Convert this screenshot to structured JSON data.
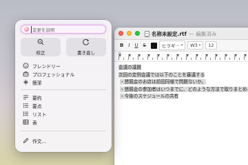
{
  "document_window": {
    "filename": "名称未設定.rtf",
    "separator": "—",
    "state": "編集済み",
    "toolbar": {
      "bold": "B",
      "italic": "I",
      "underline": "U",
      "strikethrough": "S",
      "color": "#111111",
      "font": "ヒラギ···",
      "weight": "W3",
      "size": "12"
    },
    "ruler": {
      "zero_label": "0"
    },
    "content": [
      "会議の議題",
      "次回の定例会議では以下のことを審議する",
      "・懇親会のお店は前回同様で問題ないか。",
      "・懇親会の参加者はいつまでに、どのような方法で取りまとめる",
      "・今後のスケジュールの共有"
    ]
  },
  "writing_tools": {
    "describe_placeholder": "変更を説明",
    "proofread": {
      "label": "校正",
      "icon": "magnifier-icon"
    },
    "rewrite": {
      "label": "書き直し",
      "icon": "rewrite-icon"
    },
    "tone_items": [
      {
        "label": "フレンドリー",
        "icon": "smiley-icon"
      },
      {
        "label": "プロフェッショナル",
        "icon": "briefcase-icon"
      },
      {
        "label": "簡潔",
        "icon": "concise-icon"
      }
    ],
    "transform_items": [
      {
        "label": "要約",
        "icon": "summary-icon"
      },
      {
        "label": "要点",
        "icon": "key-points-icon"
      },
      {
        "label": "リスト",
        "icon": "list-icon"
      },
      {
        "label": "表",
        "icon": "table-icon"
      }
    ],
    "compose": {
      "label": "作文...",
      "icon": "pencil-icon"
    },
    "accent_color": "#e3a9e6"
  }
}
